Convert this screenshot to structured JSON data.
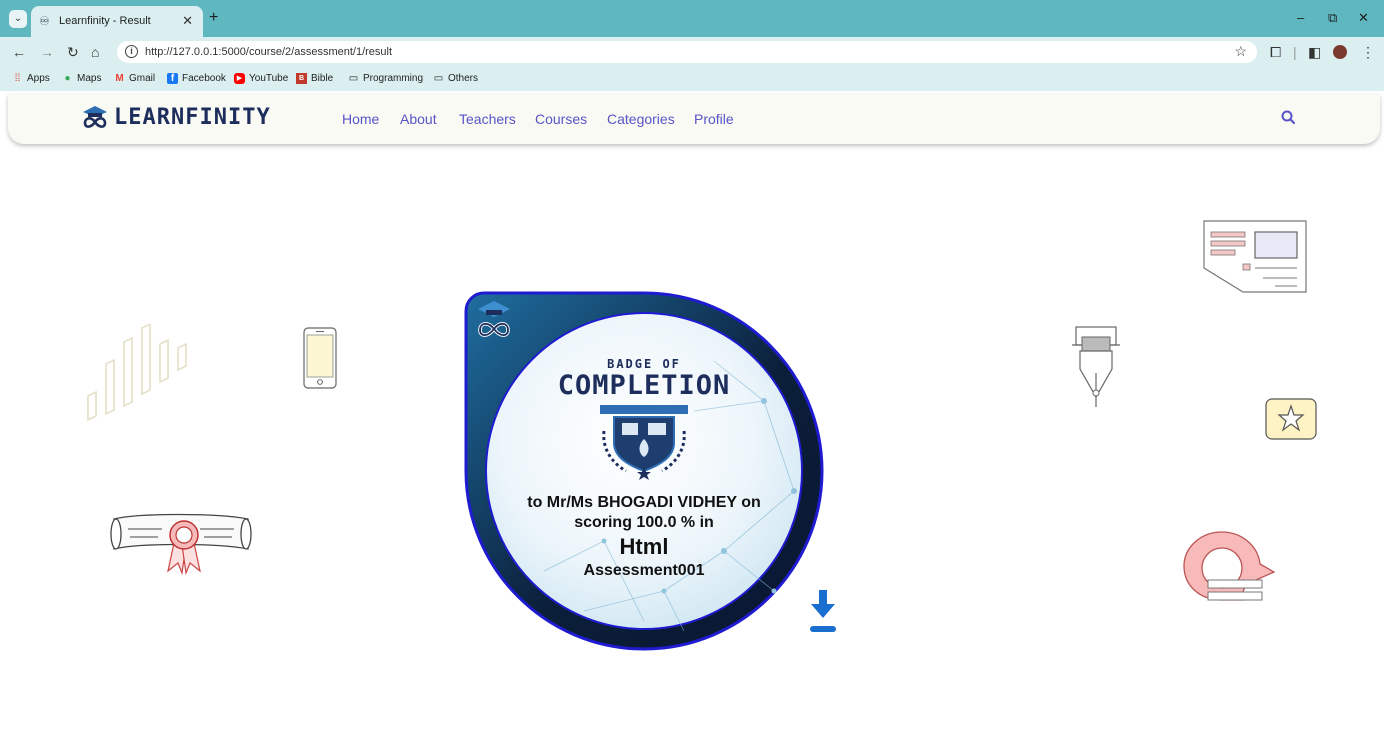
{
  "browser": {
    "tab_title": "Learnfinity - Result",
    "url": "http://127.0.0.1:5000/course/2/assessment/1/result",
    "bookmarks": [
      "Apps",
      "Maps",
      "Gmail",
      "Facebook",
      "YouTube",
      "Bible",
      "Programming",
      "Others"
    ],
    "window_controls": {
      "minimize": "–",
      "restore": "⧉",
      "close": "✕"
    }
  },
  "site": {
    "brand": "LEARNFINITY",
    "nav": [
      "Home",
      "About",
      "Teachers",
      "Courses",
      "Categories",
      "Profile"
    ],
    "accent_color": "#5a54c9"
  },
  "badge": {
    "header_small": "BADGE OF",
    "header_large": "COMPLETION",
    "emblem_text": "LEARNFINITY",
    "line1": "to Mr/Ms BHOGADI VIDHEY on",
    "line2": "scoring 100.0 % in",
    "course": "Html",
    "assessment": "Assessment001",
    "border_color": "#1f1bd1"
  },
  "icons": {
    "search": "search-icon",
    "download": "download-icon"
  }
}
